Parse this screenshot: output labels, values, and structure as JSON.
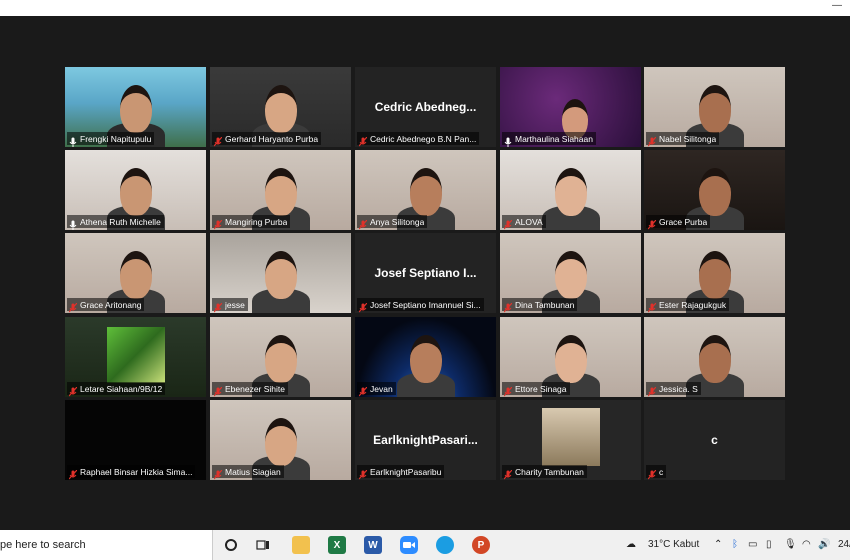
{
  "window": {
    "minimize_glyph": "—"
  },
  "participants": [
    {
      "name": "Frengki Napitupulu",
      "muted": false,
      "active": true,
      "video": "mountain-banner"
    },
    {
      "name": "Gerhard Haryanto Purba",
      "muted": true,
      "video": "person-headphones"
    },
    {
      "name": "Cedric Abednego B.N Pan...",
      "display_name": "Cedric Abedneg...",
      "muted": true,
      "video": "none"
    },
    {
      "name": "Marthaulina Siahaan",
      "muted": false,
      "video": "purple-space"
    },
    {
      "name": "Nabel Silitonga",
      "muted": true,
      "video": "person"
    },
    {
      "name": "Athena Ruth Michelle",
      "muted": false,
      "video": "person-room"
    },
    {
      "name": "Mangiring Purba",
      "muted": true,
      "video": "person"
    },
    {
      "name": "Anya Silitonga",
      "muted": true,
      "video": "person"
    },
    {
      "name": "ALOVA",
      "muted": true,
      "video": "person-room"
    },
    {
      "name": "Grace Purba",
      "muted": true,
      "video": "dim-person"
    },
    {
      "name": "Grace Aritonang",
      "muted": true,
      "video": "person"
    },
    {
      "name": "jesse",
      "muted": true,
      "video": "person-bed"
    },
    {
      "name": "Josef Septiano Imannuel Si...",
      "display_name": "Josef Septiano I...",
      "muted": true,
      "video": "none"
    },
    {
      "name": "Dina Tambunan",
      "muted": true,
      "video": "person"
    },
    {
      "name": "Ester Rajagukguk",
      "muted": true,
      "video": "person"
    },
    {
      "name": "Letare Siahaan/9B/12",
      "muted": true,
      "video": "anime"
    },
    {
      "name": "Ebenezer Sihite",
      "muted": true,
      "video": "person"
    },
    {
      "name": "Jevan",
      "muted": true,
      "video": "earth"
    },
    {
      "name": "Ettore Sinaga",
      "muted": true,
      "video": "person"
    },
    {
      "name": "Jessica. S",
      "muted": true,
      "video": "person"
    },
    {
      "name": "Raphael Binsar Hizkia Sima...",
      "muted": true,
      "video": "black"
    },
    {
      "name": "Matius Siagian",
      "muted": true,
      "video": "person"
    },
    {
      "name": "EarlknightPasaribu",
      "display_name": "EarlknightPasari...",
      "muted": true,
      "video": "none"
    },
    {
      "name": "Charity Tambunan",
      "muted": true,
      "video": "photo"
    },
    {
      "name": "c",
      "display_name": "c",
      "muted": true,
      "video": "none"
    }
  ],
  "taskbar": {
    "search_placeholder": "pe here to search",
    "apps": [
      "cortana",
      "task-view",
      "file-explorer",
      "excel",
      "word",
      "zoom",
      "edge",
      "powerpoint"
    ],
    "weather": "31°C  Kabut",
    "clock": "24/"
  },
  "colors": {
    "active_border": "#b5d33c",
    "muted_red": "#e0312a",
    "bg": "#1a1a1a"
  }
}
